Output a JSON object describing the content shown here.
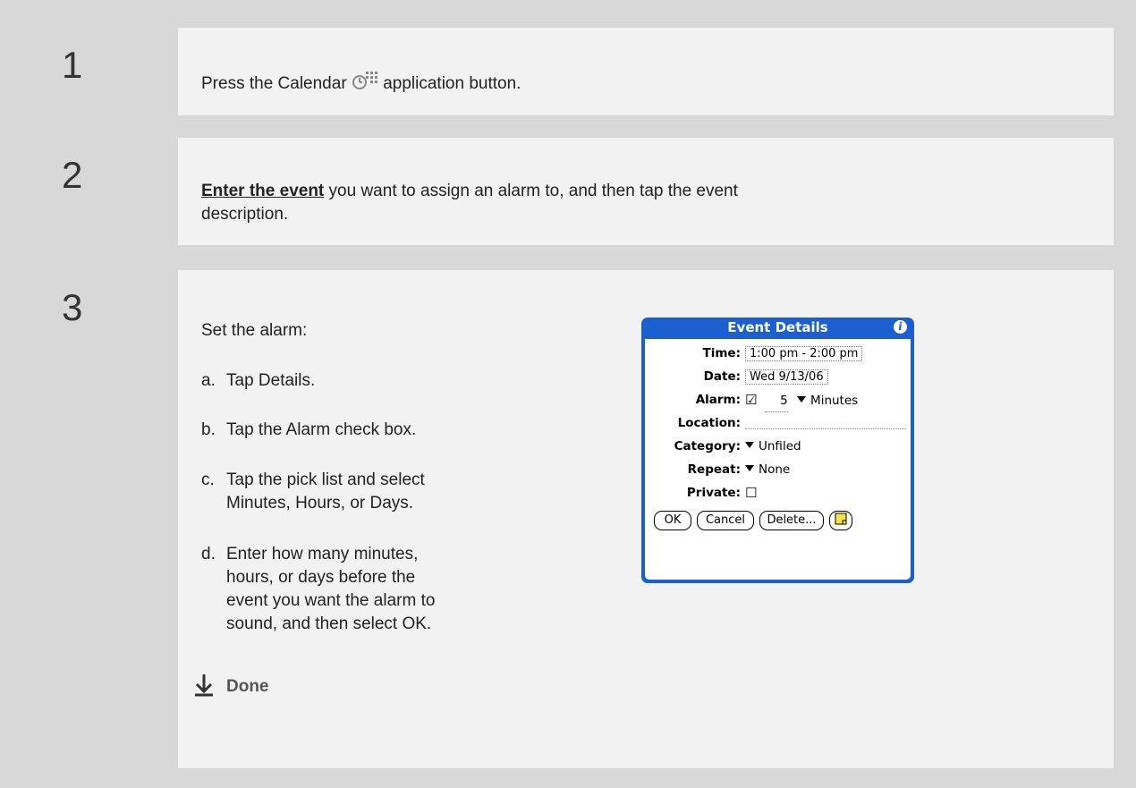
{
  "steps": [
    {
      "number": "1",
      "text_before": "Press the Calendar",
      "text_after": "application button.",
      "icon": "calendar-icon"
    },
    {
      "number": "2",
      "link": "Enter the event",
      "text": "you want to assign an alarm to, and then tap the event",
      "text_line2": "description."
    },
    {
      "number": "3",
      "intro": "Set the alarm:",
      "substeps": [
        {
          "letter": "a.",
          "lines": [
            "Tap Details."
          ]
        },
        {
          "letter": "b.",
          "lines": [
            "Tap the Alarm check box."
          ]
        },
        {
          "letter": "c.",
          "lines": [
            "Tap the pick list and select",
            "Minutes, Hours, or Days."
          ]
        },
        {
          "letter": "d.",
          "lines": [
            "Enter how many minutes,",
            "hours, or days before the",
            "event you want the alarm to",
            "sound, and then select OK."
          ]
        }
      ],
      "done_label": "Done"
    }
  ],
  "dialog": {
    "title": "Event Details",
    "info_icon": "info-icon",
    "time_label": "Time:",
    "time_value": "1:00 pm - 2:00 pm",
    "date_label": "Date:",
    "date_value": "Wed 9/13/06",
    "alarm_label": "Alarm:",
    "alarm_checked": "☑",
    "alarm_amount": "5",
    "alarm_unit": "Minutes",
    "location_label": "Location:",
    "category_label": "Category:",
    "category_value": "Unfiled",
    "repeat_label": "Repeat:",
    "repeat_value": "None",
    "private_label": "Private:",
    "private_checked": "☐",
    "buttons": {
      "ok": "OK",
      "cancel": "Cancel",
      "delete": "Delete..."
    },
    "note_icon": "note-icon"
  },
  "colors": {
    "frame": "#d8d8d8",
    "panel": "#f2f2f2",
    "dialog_blue": "#1b5fd0"
  }
}
